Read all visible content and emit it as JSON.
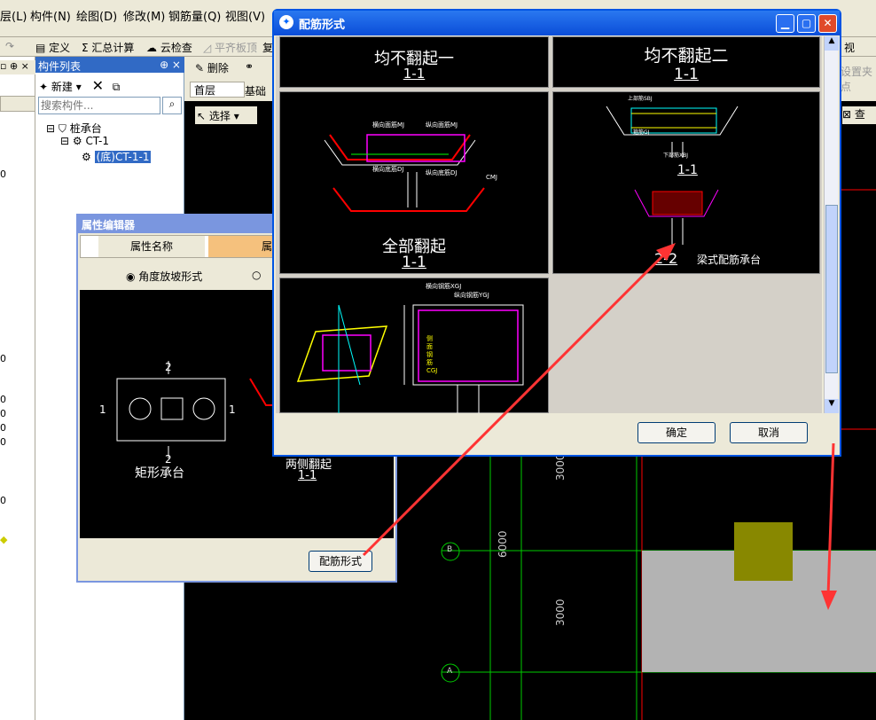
{
  "menubar": {
    "items": [
      "层(L)",
      "构件(N)",
      "绘图(D)",
      "修改(M)",
      "钢筋量(Q)",
      "视图(V)"
    ]
  },
  "toolbar": {
    "items": [
      "定义",
      "汇总计算",
      "云检查",
      "平齐板顶",
      "复"
    ],
    "right_items": [
      "视",
      "设置夹点",
      "查"
    ]
  },
  "component_panel": {
    "title": "构件列表",
    "new_label": "新建",
    "search_placeholder": "搜索构件...",
    "tree": [
      "桩承台",
      "CT-1",
      "(底)CT-1-1"
    ]
  },
  "floor_bar": {
    "floor": "首层",
    "layer": "基础",
    "select_label": "选择",
    "delete_label": "删除"
  },
  "prop_editor": {
    "title": "属性编辑器",
    "col_name": "属性名称",
    "col_value": "属",
    "radio1": "角度放坡形式",
    "radio2": "",
    "rect_label": "矩形承台",
    "rect_dim_top": "2",
    "rect_dim_bottom": "2",
    "rect_dim_left": "1",
    "rect_dim_right": "1",
    "right_caption": "两侧翻起",
    "right_sub": "1-1",
    "button": "配筋形式"
  },
  "dialog": {
    "title": "配筋形式",
    "cells": [
      {
        "caption": "均不翻起一",
        "sub": "1-1"
      },
      {
        "caption": "均不翻起二",
        "sub": "1-1"
      },
      {
        "caption": "全部翻起",
        "sub": "1-1"
      },
      {
        "caption": "梁式配筋承台",
        "sub": "2-2"
      }
    ],
    "labels": {
      "heng": "横向面筋MJ",
      "zong": "纵向面筋MJ",
      "hengdi": "横向底筋DJ",
      "zongdi": "纵向底筋DJ",
      "cmj": "CMJ",
      "shangbu": "上部筋SBJ",
      "xiabu": "下部筋XBJ",
      "gj": "箍筋GJ",
      "gjxg": "横向钢筋XGJ",
      "zxgj": "纵向钢筋YGJ",
      "cgj": "侧面钢筋 CGJ"
    },
    "ok": "确定",
    "cancel": "取消"
  },
  "cad": {
    "dims": [
      "3000",
      "6000",
      "3000"
    ],
    "axes": [
      "B",
      "A"
    ]
  },
  "left_numbers": [
    "0",
    "0",
    "0",
    "0",
    "0",
    "0",
    "0"
  ]
}
